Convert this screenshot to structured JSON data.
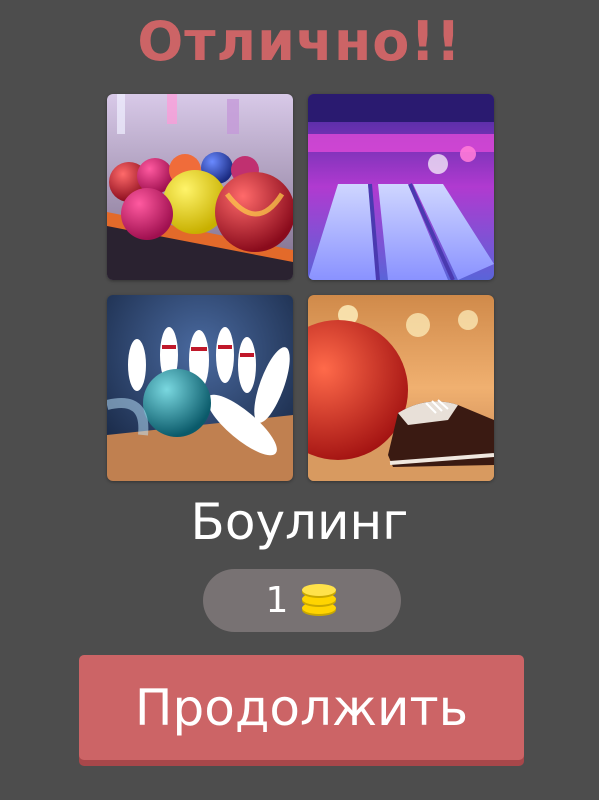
{
  "header": {
    "title": "Отлично!!"
  },
  "puzzle": {
    "images": [
      {
        "icon": "bowling-balls-rack-photo"
      },
      {
        "icon": "bowling-alley-lanes-photo"
      },
      {
        "icon": "bowling-strike-pins-photo"
      },
      {
        "icon": "bowling-ball-and-shoes-photo"
      }
    ],
    "answer": "Боулинг"
  },
  "reward": {
    "value": "1",
    "icon": "coins-icon"
  },
  "actions": {
    "continue_label": "Продолжить"
  },
  "colors": {
    "background": "#4d4d4d",
    "accent": "#cc6466",
    "reward_pill": "#787273",
    "coin": "#ffd400"
  }
}
